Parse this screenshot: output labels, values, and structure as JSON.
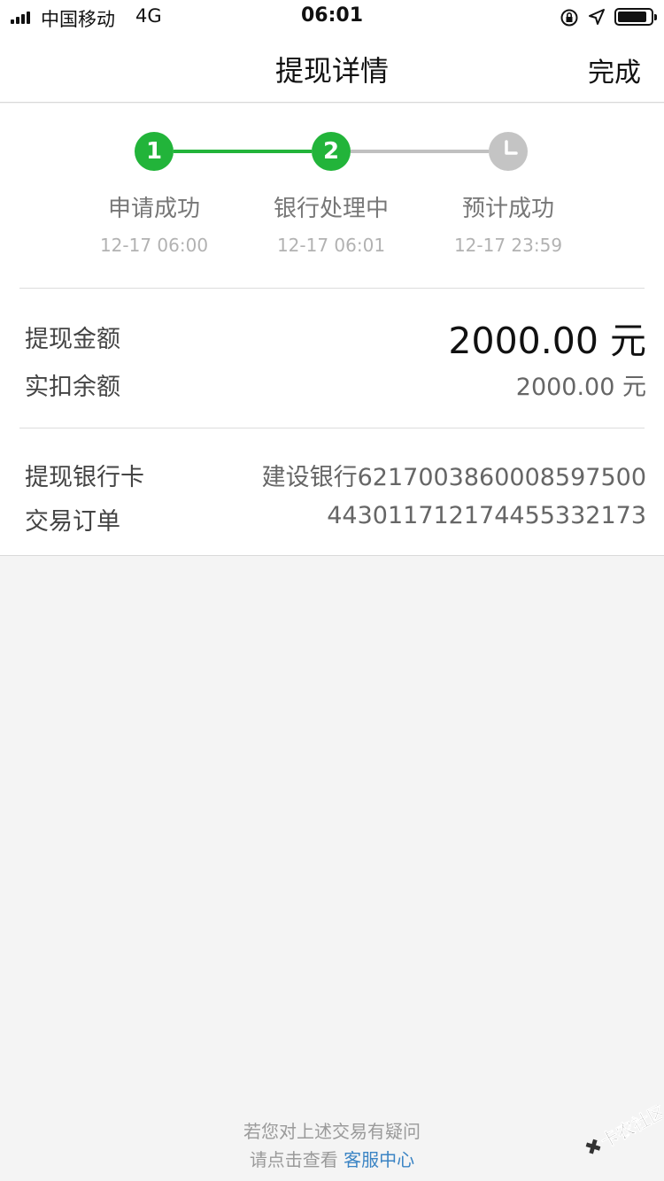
{
  "status_bar": {
    "carrier": "中国移动",
    "network": "4G",
    "time": "06:01"
  },
  "nav": {
    "title": "提现详情",
    "done": "完成"
  },
  "steps": [
    {
      "number": "1",
      "label": "申请成功",
      "time": "12-17 06:00",
      "state": "done",
      "color": "#22b43a"
    },
    {
      "number": "2",
      "label": "银行处理中",
      "time": "12-17 06:01",
      "state": "current",
      "color": "#22b43a"
    },
    {
      "number": "",
      "label": "预计成功",
      "time": "12-17 23:59",
      "state": "pending",
      "icon": "clock-icon",
      "color": "#c4c4c4"
    }
  ],
  "details": {
    "amount_label": "提现金额",
    "amount_value": "2000.00 元",
    "deduct_label": "实扣余额",
    "deduct_value": "2000.00 元",
    "bank_label": "提现银行卡",
    "bank_value": "建设银行6217003860008597500",
    "order_label": "交易订单",
    "order_value": "4430117121744553321​73"
  },
  "footer": {
    "line1": "若您对上述交易有疑问",
    "line2_prefix": "请点击查看 ",
    "link": "客服中心"
  },
  "watermark": {
    "text": "卡农社区"
  },
  "colors": {
    "accent_green": "#22b43a",
    "link_blue": "#3b84c4",
    "pending_gray": "#c4c4c4"
  }
}
